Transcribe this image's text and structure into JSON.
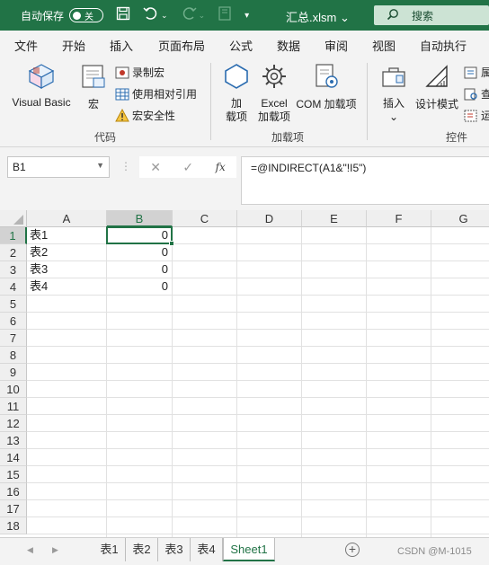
{
  "titlebar": {
    "autosave_label": "自动保存",
    "autosave_state": "关",
    "filename": "汇总.xlsm",
    "filename_caret": "⌄",
    "search_placeholder": "搜索",
    "accent": "#217346"
  },
  "menu": [
    "文件",
    "开始",
    "插入",
    "页面布局",
    "公式",
    "数据",
    "审阅",
    "视图",
    "自动执行"
  ],
  "ribbon": {
    "code_group": {
      "label": "代码",
      "visual_basic": "Visual Basic",
      "macro": "宏",
      "record_macro": "录制宏",
      "relative_ref": "使用相对引用",
      "macro_security": "宏安全性"
    },
    "addins_group": {
      "label": "加载项",
      "addins_line1": "加",
      "addins_line2": "载项",
      "excel_addins_line1": "Excel",
      "excel_addins_line2": "加载项",
      "com_addins": "COM 加载项"
    },
    "controls_group": {
      "label": "控件",
      "insert": "插入",
      "insert_caret": "⌄",
      "design_mode": "设计模式",
      "properties_partial": "属",
      "view_code_partial": "查",
      "run_dialog_partial": "运"
    }
  },
  "formula_bar": {
    "name_box": "B1",
    "formula": "=@INDIRECT(A1&\"!I5\")",
    "cancel": "✕",
    "enter": "✓",
    "fx": "fx"
  },
  "grid": {
    "columns": [
      "A",
      "B",
      "C",
      "D",
      "E",
      "F",
      "G"
    ],
    "active_column": "B",
    "rows": [
      "1",
      "2",
      "3",
      "4",
      "5",
      "6",
      "7",
      "8",
      "9",
      "10",
      "11",
      "12",
      "13",
      "14",
      "15",
      "16",
      "17",
      "18"
    ],
    "active_row": "1",
    "cells": {
      "A1": "表1",
      "A2": "表2",
      "A3": "表3",
      "A4": "表4",
      "B1": "0",
      "B2": "0",
      "B3": "0",
      "B4": "0"
    }
  },
  "sheet_tabs": {
    "prev": "◀",
    "next": "▶",
    "tabs": [
      "表1",
      "表2",
      "表3",
      "表4",
      "Sheet1"
    ],
    "active": "Sheet1",
    "add": "+",
    "watermark": "CSDN @M-1015"
  }
}
